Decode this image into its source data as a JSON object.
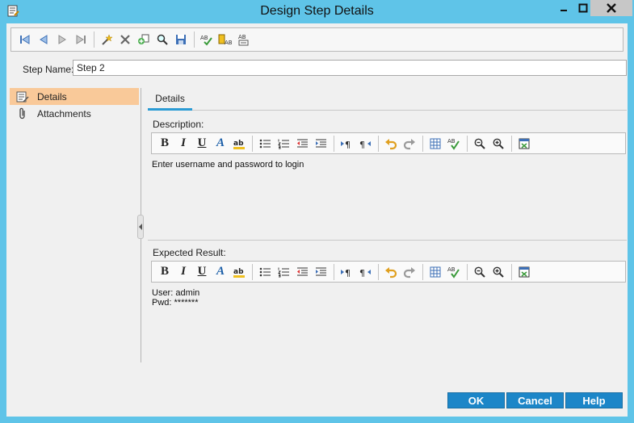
{
  "window": {
    "title": "Design Step Details",
    "minimize_icon": "minimize-icon",
    "maximize_icon": "maximize-icon",
    "close_icon": "close-icon"
  },
  "toolbar": {
    "groups": [
      [
        "first-icon",
        "previous-icon",
        "next-icon",
        "last-icon"
      ],
      [
        "new-step-icon",
        "delete-icon",
        "insert-parameter-icon",
        "find-icon",
        "save-icon"
      ],
      [
        "spell-check-icon",
        "thesaurus-icon",
        "spelling-options-icon"
      ]
    ]
  },
  "step_name": {
    "label": "Step Name:",
    "value": "Step 2"
  },
  "nav": {
    "items": [
      {
        "label": "Details",
        "icon": "details-icon",
        "active": true
      },
      {
        "label": "Attachments",
        "icon": "paperclip-icon",
        "active": false
      }
    ]
  },
  "tabs": [
    {
      "label": "Details",
      "active": true
    }
  ],
  "description": {
    "label": "Description:",
    "text": "Enter username and password to login"
  },
  "expected_result": {
    "label": "Expected Result:",
    "line1": "User: admin",
    "line2": "Pwd: *******"
  },
  "rich_text_toolbar": {
    "bold": "B",
    "italic": "I",
    "underline": "U",
    "font_color": "A"
  },
  "buttons": {
    "ok": "OK",
    "cancel": "Cancel",
    "help": "Help"
  },
  "colors": {
    "frame": "#5fc4e8",
    "accent_button": "#1c86c8",
    "selected_nav": "#f9c999",
    "tab_underline": "#2a9bd4"
  }
}
